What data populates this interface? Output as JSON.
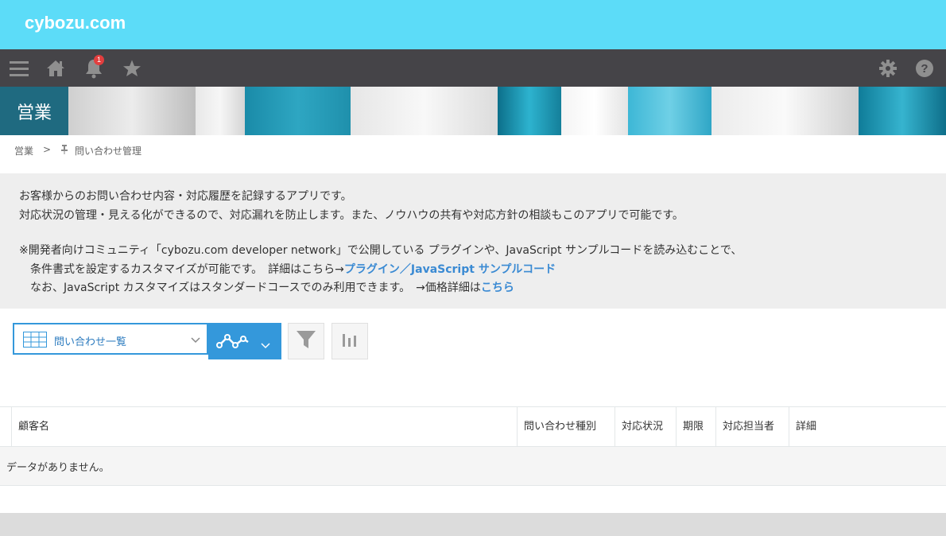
{
  "brand": {
    "logo": "cybozu.com"
  },
  "navbar": {
    "notification_count": "1",
    "icons": [
      "menu-icon",
      "home-icon",
      "bell-icon",
      "star-icon",
      "gear-icon",
      "help-icon"
    ]
  },
  "space": {
    "title": "営業"
  },
  "breadcrumb": {
    "space": "営業",
    "separator": ">",
    "app": "問い合わせ管理"
  },
  "description": {
    "line1": "お客様からのお問い合わせ内容・対応履歴を記録するアプリです。",
    "line2": "対応状況の管理・見える化ができるので、対応漏れを防止します。また、ノウハウの共有や対応方針の相談もこのアプリで可能です。",
    "line3": "※開発者向けコミュニティ「cybozu.com developer network」で公開している プラグインや、JavaScript サンプルコードを読み込むことで、",
    "line4_prefix": "条件書式を設定するカスタマイズが可能です。　詳細はこちら→",
    "line4_link": "プラグイン／JavaScript サンプルコード",
    "line5_prefix": "なお、JavaScript カスタマイズはスタンダードコースでのみ利用できます。　→価格詳細は",
    "line5_link": "こちら"
  },
  "toolbar": {
    "view_label": "問い合わせ一覧"
  },
  "table": {
    "columns": [
      "顧客名",
      "問い合わせ種別",
      "対応状況",
      "期限",
      "対応担当者",
      "詳細"
    ],
    "empty_message": "データがありません。"
  },
  "colors": {
    "brand": "#5cdcf8",
    "navbar": "#454448",
    "accent": "#3498db",
    "space_title_bg": "#1f6a80"
  }
}
